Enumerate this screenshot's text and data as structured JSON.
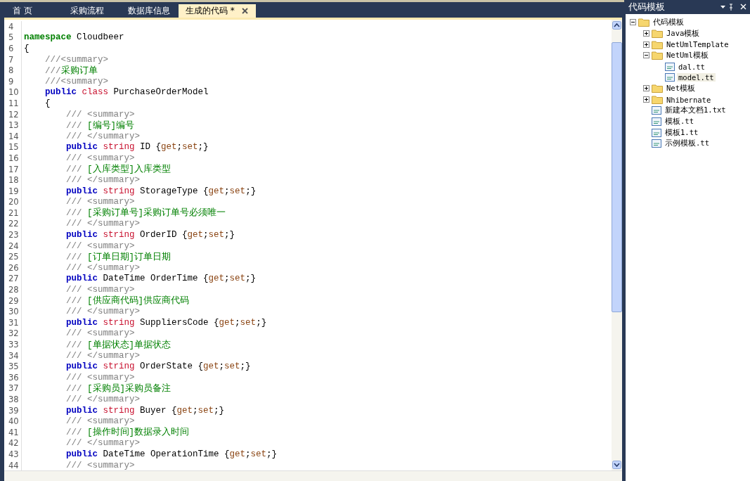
{
  "tabs": [
    {
      "label": "首 页",
      "selected": false
    },
    {
      "label": "采购流程",
      "selected": false
    },
    {
      "label": "数据库信息",
      "selected": false
    },
    {
      "label": "生成的代码 *",
      "selected": true
    }
  ],
  "editor": {
    "lines": [
      {
        "number": "4"
      },
      {
        "number": "5",
        "tokens": [
          {
            "kind": "ns",
            "text": "namespace "
          },
          {
            "kind": "plain",
            "text": "Cloudbeer"
          }
        ]
      },
      {
        "number": "6",
        "tokens": [
          {
            "kind": "plain",
            "text": "{"
          }
        ]
      },
      {
        "number": "7",
        "tokens": [
          {
            "kind": "doc",
            "text": "    ///<summary>"
          }
        ]
      },
      {
        "number": "8",
        "tokens": [
          {
            "kind": "doc",
            "text": "    ///"
          },
          {
            "kind": "comment",
            "text": "采购订单"
          }
        ]
      },
      {
        "number": "9",
        "tokens": [
          {
            "kind": "doc",
            "text": "    ///<summary>"
          }
        ]
      },
      {
        "number": "10",
        "tokens": [
          {
            "kind": "keyword",
            "text": "    public "
          },
          {
            "kind": "type",
            "text": "class "
          },
          {
            "kind": "plain",
            "text": "PurchaseOrderModel"
          }
        ]
      },
      {
        "number": "11",
        "tokens": [
          {
            "kind": "plain",
            "text": "    {"
          }
        ]
      },
      {
        "number": "12",
        "tokens": [
          {
            "kind": "doc",
            "text": "        /// <summary>"
          }
        ]
      },
      {
        "number": "13",
        "tokens": [
          {
            "kind": "doc",
            "text": "        /// "
          },
          {
            "kind": "comment",
            "text": "[编号]编号"
          }
        ]
      },
      {
        "number": "14",
        "tokens": [
          {
            "kind": "doc",
            "text": "        /// </summary>"
          }
        ]
      },
      {
        "number": "15",
        "tokens": [
          {
            "kind": "keyword",
            "text": "        public "
          },
          {
            "kind": "type",
            "text": "string "
          },
          {
            "kind": "plain",
            "text": "ID {"
          },
          {
            "kind": "accessor",
            "text": "get"
          },
          {
            "kind": "plain",
            "text": ";"
          },
          {
            "kind": "accessor",
            "text": "set"
          },
          {
            "kind": "plain",
            "text": ";}"
          }
        ]
      },
      {
        "number": "16",
        "tokens": [
          {
            "kind": "doc",
            "text": "        /// <summary>"
          }
        ]
      },
      {
        "number": "17",
        "tokens": [
          {
            "kind": "doc",
            "text": "        /// "
          },
          {
            "kind": "comment",
            "text": "[入库类型]入库类型"
          }
        ]
      },
      {
        "number": "18",
        "tokens": [
          {
            "kind": "doc",
            "text": "        /// </summary>"
          }
        ]
      },
      {
        "number": "19",
        "tokens": [
          {
            "kind": "keyword",
            "text": "        public "
          },
          {
            "kind": "type",
            "text": "string "
          },
          {
            "kind": "plain",
            "text": "StorageType {"
          },
          {
            "kind": "accessor",
            "text": "get"
          },
          {
            "kind": "plain",
            "text": ";"
          },
          {
            "kind": "accessor",
            "text": "set"
          },
          {
            "kind": "plain",
            "text": ";}"
          }
        ]
      },
      {
        "number": "20",
        "tokens": [
          {
            "kind": "doc",
            "text": "        /// <summary>"
          }
        ]
      },
      {
        "number": "21",
        "tokens": [
          {
            "kind": "doc",
            "text": "        /// "
          },
          {
            "kind": "comment",
            "text": "[采购订单号]采购订单号必须唯一"
          }
        ]
      },
      {
        "number": "22",
        "tokens": [
          {
            "kind": "doc",
            "text": "        /// </summary>"
          }
        ]
      },
      {
        "number": "23",
        "tokens": [
          {
            "kind": "keyword",
            "text": "        public "
          },
          {
            "kind": "type",
            "text": "string "
          },
          {
            "kind": "plain",
            "text": "OrderID {"
          },
          {
            "kind": "accessor",
            "text": "get"
          },
          {
            "kind": "plain",
            "text": ";"
          },
          {
            "kind": "accessor",
            "text": "set"
          },
          {
            "kind": "plain",
            "text": ";}"
          }
        ]
      },
      {
        "number": "24",
        "tokens": [
          {
            "kind": "doc",
            "text": "        /// <summary>"
          }
        ]
      },
      {
        "number": "25",
        "tokens": [
          {
            "kind": "doc",
            "text": "        /// "
          },
          {
            "kind": "comment",
            "text": "[订单日期]订单日期"
          }
        ]
      },
      {
        "number": "26",
        "tokens": [
          {
            "kind": "doc",
            "text": "        /// </summary>"
          }
        ]
      },
      {
        "number": "27",
        "tokens": [
          {
            "kind": "keyword",
            "text": "        public "
          },
          {
            "kind": "plain",
            "text": "DateTime OrderTime {"
          },
          {
            "kind": "accessor",
            "text": "get"
          },
          {
            "kind": "plain",
            "text": ";"
          },
          {
            "kind": "accessor",
            "text": "set"
          },
          {
            "kind": "plain",
            "text": ";}"
          }
        ]
      },
      {
        "number": "28",
        "tokens": [
          {
            "kind": "doc",
            "text": "        /// <summary>"
          }
        ]
      },
      {
        "number": "29",
        "tokens": [
          {
            "kind": "doc",
            "text": "        /// "
          },
          {
            "kind": "comment",
            "text": "[供应商代码]供应商代码"
          }
        ]
      },
      {
        "number": "30",
        "tokens": [
          {
            "kind": "doc",
            "text": "        /// </summary>"
          }
        ]
      },
      {
        "number": "31",
        "tokens": [
          {
            "kind": "keyword",
            "text": "        public "
          },
          {
            "kind": "type",
            "text": "string "
          },
          {
            "kind": "plain",
            "text": "SuppliersCode {"
          },
          {
            "kind": "accessor",
            "text": "get"
          },
          {
            "kind": "plain",
            "text": ";"
          },
          {
            "kind": "accessor",
            "text": "set"
          },
          {
            "kind": "plain",
            "text": ";}"
          }
        ]
      },
      {
        "number": "32",
        "tokens": [
          {
            "kind": "doc",
            "text": "        /// <summary>"
          }
        ]
      },
      {
        "number": "33",
        "tokens": [
          {
            "kind": "doc",
            "text": "        /// "
          },
          {
            "kind": "comment",
            "text": "[单据状态]单据状态"
          }
        ]
      },
      {
        "number": "34",
        "tokens": [
          {
            "kind": "doc",
            "text": "        /// </summary>"
          }
        ]
      },
      {
        "number": "35",
        "tokens": [
          {
            "kind": "keyword",
            "text": "        public "
          },
          {
            "kind": "type",
            "text": "string "
          },
          {
            "kind": "plain",
            "text": "OrderState {"
          },
          {
            "kind": "accessor",
            "text": "get"
          },
          {
            "kind": "plain",
            "text": ";"
          },
          {
            "kind": "accessor",
            "text": "set"
          },
          {
            "kind": "plain",
            "text": ";}"
          }
        ]
      },
      {
        "number": "36",
        "tokens": [
          {
            "kind": "doc",
            "text": "        /// <summary>"
          }
        ]
      },
      {
        "number": "37",
        "tokens": [
          {
            "kind": "doc",
            "text": "        /// "
          },
          {
            "kind": "comment",
            "text": "[采购员]采购员备注"
          }
        ]
      },
      {
        "number": "38",
        "tokens": [
          {
            "kind": "doc",
            "text": "        /// </summary>"
          }
        ]
      },
      {
        "number": "39",
        "tokens": [
          {
            "kind": "keyword",
            "text": "        public "
          },
          {
            "kind": "type",
            "text": "string "
          },
          {
            "kind": "plain",
            "text": "Buyer {"
          },
          {
            "kind": "accessor",
            "text": "get"
          },
          {
            "kind": "plain",
            "text": ";"
          },
          {
            "kind": "accessor",
            "text": "set"
          },
          {
            "kind": "plain",
            "text": ";}"
          }
        ]
      },
      {
        "number": "40",
        "tokens": [
          {
            "kind": "doc",
            "text": "        /// <summary>"
          }
        ]
      },
      {
        "number": "41",
        "tokens": [
          {
            "kind": "doc",
            "text": "        /// "
          },
          {
            "kind": "comment",
            "text": "[操作时间]数据录入时间"
          }
        ]
      },
      {
        "number": "42",
        "tokens": [
          {
            "kind": "doc",
            "text": "        /// </summary>"
          }
        ]
      },
      {
        "number": "43",
        "tokens": [
          {
            "kind": "keyword",
            "text": "        public "
          },
          {
            "kind": "plain",
            "text": "DateTime OperationTime {"
          },
          {
            "kind": "accessor",
            "text": "get"
          },
          {
            "kind": "plain",
            "text": ";"
          },
          {
            "kind": "accessor",
            "text": "set"
          },
          {
            "kind": "plain",
            "text": ";}"
          }
        ]
      },
      {
        "number": "44",
        "tokens": [
          {
            "kind": "doc",
            "text": "        /// <summary>"
          }
        ]
      }
    ]
  },
  "panel": {
    "title": "代码模板",
    "tree": [
      {
        "kind": "folder",
        "label": "代码模板",
        "expanded": true,
        "selected": false,
        "children": [
          {
            "kind": "folder",
            "label": "Java模板",
            "expanded": false,
            "selected": false
          },
          {
            "kind": "folder",
            "label": "NetUmlTemplate",
            "expanded": false,
            "selected": false
          },
          {
            "kind": "folder",
            "label": "NetUml模板",
            "expanded": true,
            "selected": false,
            "children": [
              {
                "kind": "file",
                "label": "dal.tt",
                "selected": false
              },
              {
                "kind": "file",
                "label": "model.tt",
                "selected": true
              }
            ]
          },
          {
            "kind": "folder",
            "label": "Net模板",
            "expanded": false,
            "selected": false
          },
          {
            "kind": "folder",
            "label": "Nhibernate",
            "expanded": false,
            "selected": false
          },
          {
            "kind": "file",
            "label": "新建本文档1.txt",
            "selected": false
          },
          {
            "kind": "file",
            "label": "模板.tt",
            "selected": false
          },
          {
            "kind": "file",
            "label": "模板1.tt",
            "selected": false
          },
          {
            "kind": "file",
            "label": "示例模板.tt",
            "selected": false
          }
        ]
      }
    ]
  }
}
